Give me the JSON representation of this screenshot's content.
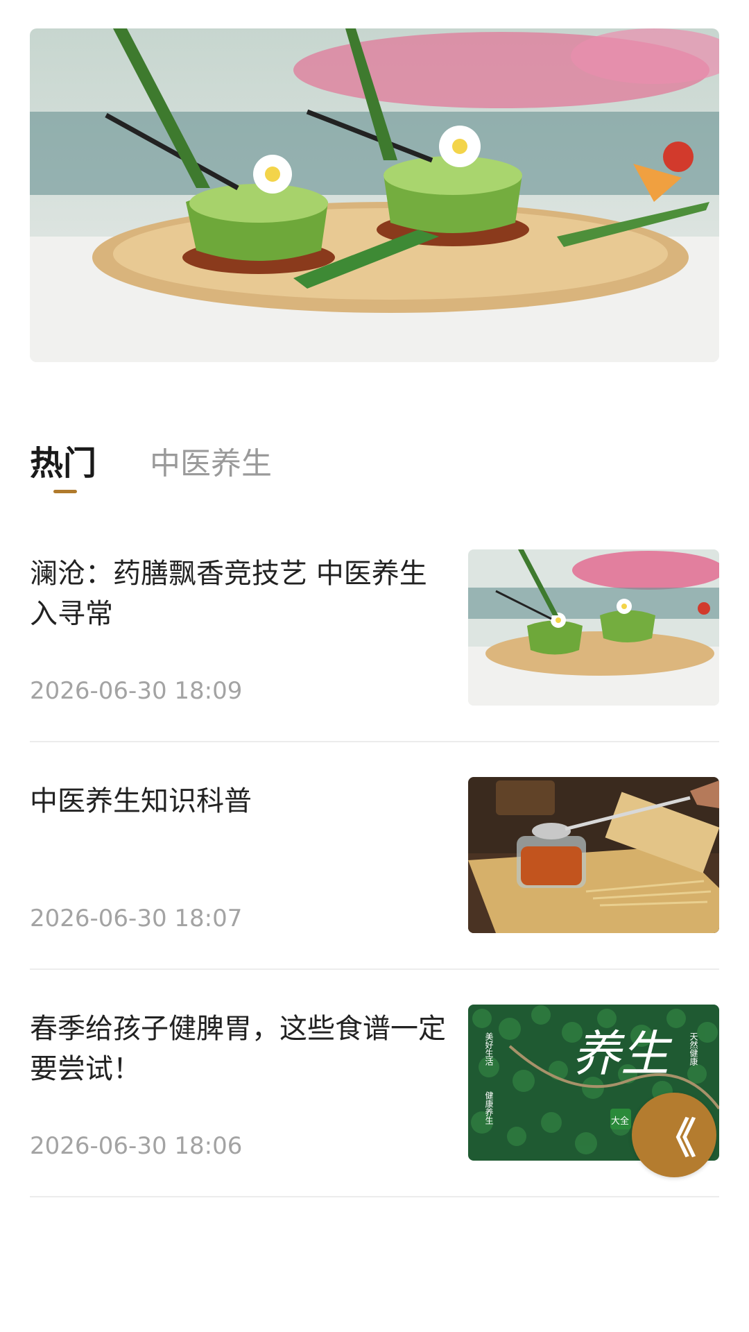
{
  "banner": {
    "image": "matcha-drinks-on-bamboo-tray",
    "dots_total": 3,
    "active_dot": 1
  },
  "tabs": [
    {
      "label": "热门",
      "active": true
    },
    {
      "label": "中医养生",
      "active": false
    }
  ],
  "articles": [
    {
      "title": "澜沧：药膳飘香竞技艺 中医养生入寻常",
      "time": "2026-06-30 18:09",
      "thumbnail": "matcha-drinks-photo"
    },
    {
      "title": "中医养生知识科普",
      "time": "2026-06-30 18:07",
      "thumbnail": "goji-jar-and-book-photo"
    },
    {
      "title": "春季给孩子健脾胃，这些食谱一定要尝试！",
      "time": "2026-06-30 18:06",
      "thumbnail": "forest-poster-养生大全"
    }
  ],
  "thumb3_text": {
    "big": "养生",
    "badge": "大全",
    "left_line1": "美好生活",
    "left_line2": "健康养生",
    "right_line": "天然健康"
  },
  "fab": {
    "icon": "double-chevron-left-icon",
    "glyph": "《"
  },
  "colors": {
    "accent": "#b47c2f",
    "underline": "#b07a2c",
    "muted": "#9a9a9a"
  }
}
